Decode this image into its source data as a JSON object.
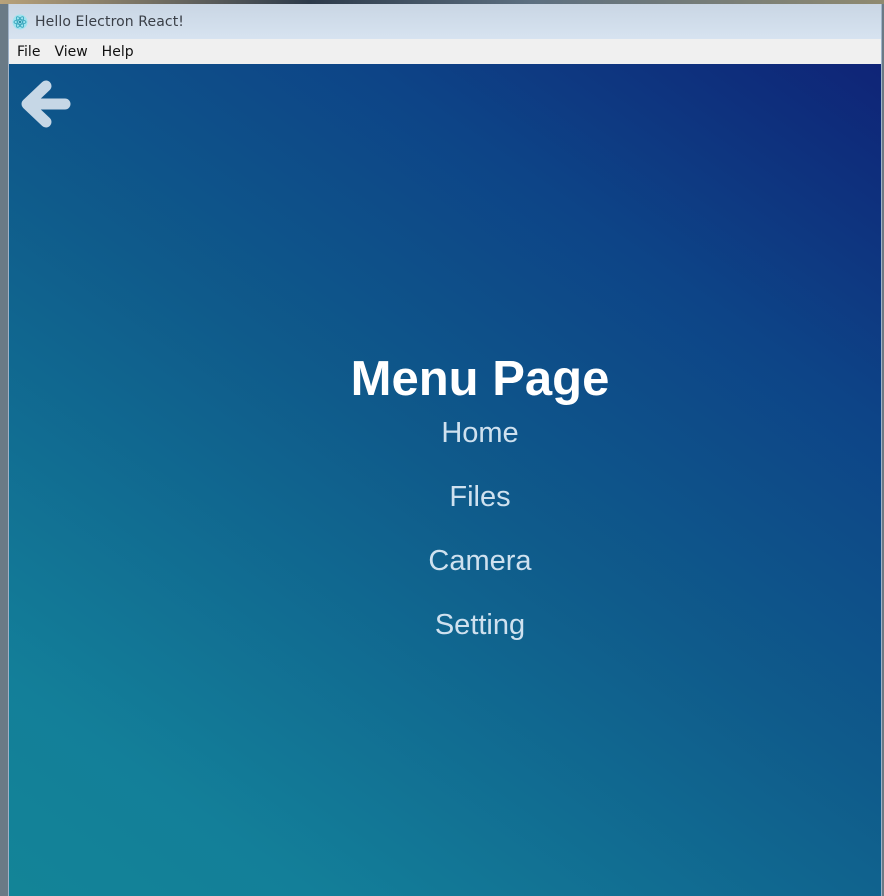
{
  "window": {
    "title": "Hello Electron React!",
    "app_icon": "electron-icon"
  },
  "menubar": {
    "items": [
      {
        "label": "File"
      },
      {
        "label": "View"
      },
      {
        "label": "Help"
      }
    ]
  },
  "page": {
    "back_icon": "arrow-left-icon",
    "title": "Menu Page",
    "nav": [
      {
        "label": "Home"
      },
      {
        "label": "Files"
      },
      {
        "label": "Camera"
      },
      {
        "label": "Setting"
      }
    ]
  },
  "colors": {
    "gradient_start": "#138497",
    "gradient_end": "#0f2477",
    "title_text": "#ffffff",
    "link_text": "#cfe1ef",
    "back_arrow": "#c6d7e6"
  }
}
